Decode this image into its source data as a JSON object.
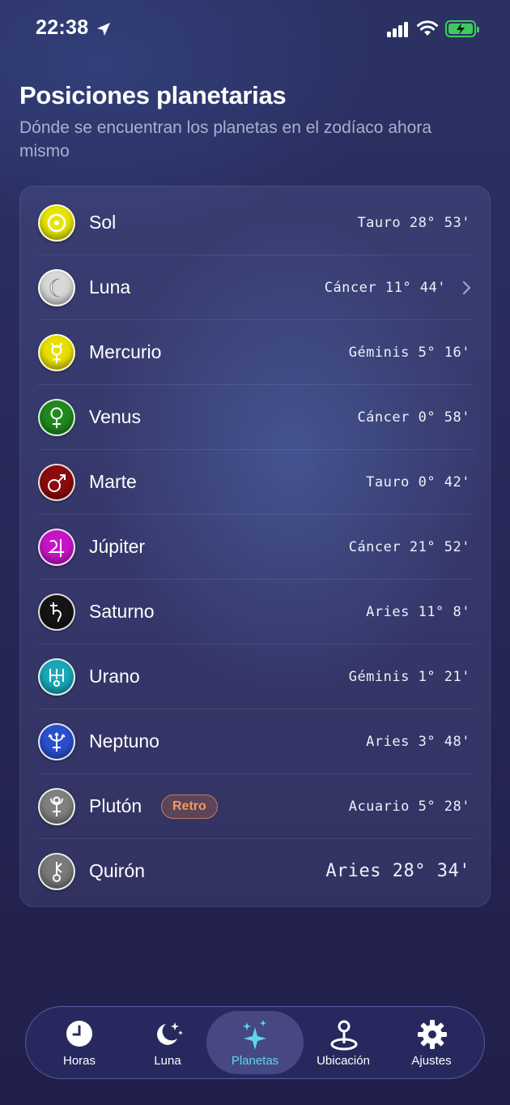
{
  "status_bar": {
    "time": "22:38"
  },
  "header": {
    "title": "Posiciones planetarias",
    "subtitle": "Dónde se encuentran los planetas en el zodíaco ahora mismo"
  },
  "planets": [
    {
      "name": "Sol",
      "position": "Tauro 28° 53'",
      "color": "#e6e400",
      "icon": "sun-icon"
    },
    {
      "name": "Luna",
      "position": "Cáncer 11° 44'",
      "color": "#d8d8d8",
      "icon": "moon-icon"
    },
    {
      "name": "Mercurio",
      "position": "Géminis 5° 16'",
      "color": "#e8e000",
      "icon": "mercury-icon"
    },
    {
      "name": "Venus",
      "position": "Cáncer 0° 58'",
      "color": "#1f8a1f",
      "icon": "venus-icon"
    },
    {
      "name": "Marte",
      "position": "Tauro 0° 42'",
      "color": "#8b0c0c",
      "icon": "mars-icon"
    },
    {
      "name": "Júpiter",
      "position": "Cáncer 21° 52'",
      "color": "#c814c8",
      "icon": "jupiter-icon"
    },
    {
      "name": "Saturno",
      "position": "Aries 11° 8'",
      "color": "#151515",
      "icon": "saturn-icon"
    },
    {
      "name": "Urano",
      "position": "Géminis 1° 21'",
      "color": "#1aa7b8",
      "icon": "uranus-icon"
    },
    {
      "name": "Neptuno",
      "position": "Aries 3° 48'",
      "color": "#2a4fd0",
      "icon": "neptune-icon"
    },
    {
      "name": "Plutón",
      "position": "Acuario 5° 28'",
      "color": "#808080",
      "icon": "pluto-icon",
      "badge": "Retro"
    },
    {
      "name": "Quirón",
      "position": "Aries 28° 34'",
      "color": "#7a7a7a",
      "icon": "chiron-icon"
    }
  ],
  "tabbar": {
    "tabs": [
      {
        "label": "Horas",
        "icon": "clock-icon"
      },
      {
        "label": "Luna",
        "icon": "moon-stars-icon"
      },
      {
        "label": "Planetas",
        "icon": "sparkles-icon",
        "active": true
      },
      {
        "label": "Ubicación",
        "icon": "location-pin-icon"
      },
      {
        "label": "Ajustes",
        "icon": "gear-icon"
      }
    ]
  },
  "colors": {
    "accent": "#5fd6f0",
    "retro": "#f39a5b",
    "battery": "#3dcb5f"
  }
}
